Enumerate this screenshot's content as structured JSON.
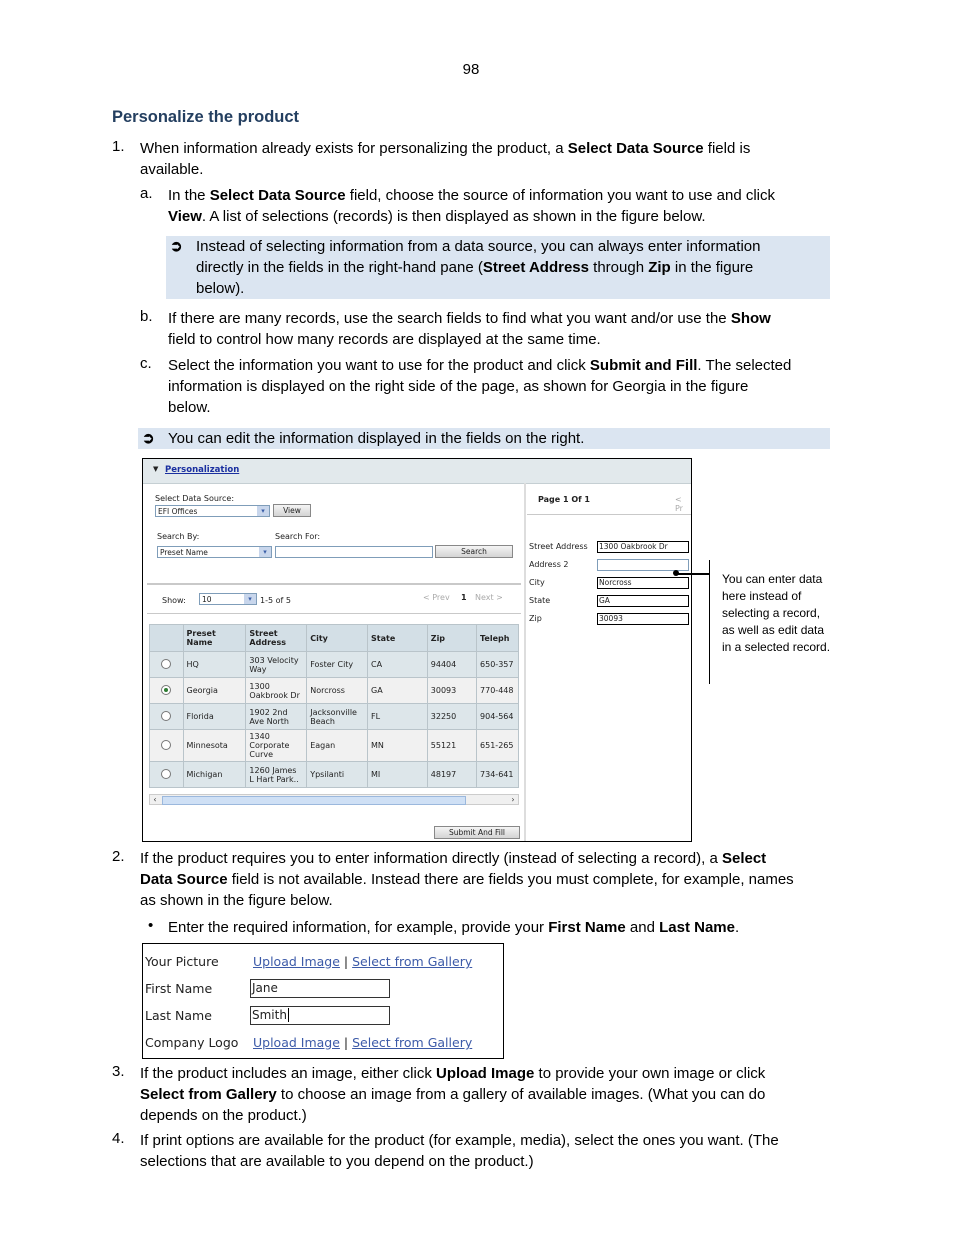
{
  "page_number": "98",
  "heading": "Personalize the product",
  "steps": {
    "s1": {
      "num": "1.",
      "pre": "When information already exists for personalizing the product, a ",
      "b1": "Select Data Source",
      "post": " field is",
      "line2": "available."
    },
    "s1a": {
      "num": "a.",
      "pre": "In the ",
      "b1": "Select Data Source",
      "mid": " field, choose the source of information you want to use and click",
      "b2": "View",
      "post": ". A list of selections (records) is then displayed as shown in the figure below."
    },
    "note1": {
      "line1": "Instead of selecting information from a data source, you can always enter information",
      "pre2": "directly in the fields in the right-hand pane (",
      "b1": "Street Address",
      "mid": " through ",
      "b2": "Zip",
      "post2": " in the figure",
      "line3": "below)."
    },
    "s1b": {
      "num": "b.",
      "pre": "If there are many records, use the search fields to find what you want and/or use the ",
      "b1": "Show",
      "line2": "field to control how many records are displayed at the same time."
    },
    "s1c": {
      "num": "c.",
      "pre": "Select the information you want to use for the product and click ",
      "b1": "Submit and Fill",
      "post": ". The selected",
      "line2": "information is displayed on the right side of the page, as shown for Georgia in the figure",
      "line3": "below."
    },
    "note2": {
      "text": "You can edit the information displayed in the fields on the right."
    },
    "s2": {
      "num": "2.",
      "pre": "If the product requires you to enter information directly (instead of selecting a record), a ",
      "b1": "Select",
      "b1b": "Data Source",
      "post": " field is not available. Instead there are fields you must complete, for example, names",
      "line3": "as shown in the figure below."
    },
    "bullet1": {
      "pre": "Enter the required information, for example, provide your ",
      "b1": "First Name",
      "mid": " and ",
      "b2": "Last Name",
      "post": "."
    },
    "s3": {
      "num": "3.",
      "pre": "If the product includes an image, either click ",
      "b1": "Upload Image",
      "post": " to provide your own image or click",
      "b2": "Select from Gallery",
      "post2": " to choose an image from a gallery of available images. (What you can do",
      "line3": "depends on the product.)"
    },
    "s4": {
      "num": "4.",
      "line1": "If print options are available for the product (for example, media), select the ones you want. (The",
      "line2": "selections that are available to you depend on the product.)"
    }
  },
  "note_arrow_glyph": "➲",
  "figure1": {
    "section_title": "Personalization",
    "data_source_label": "Select Data Source:",
    "data_source_value": "EFI Offices",
    "view_button": "View",
    "search_by_label": "Search By:",
    "search_by_value": "Preset Name",
    "search_for_label": "Search For:",
    "search_for_value": "",
    "search_button": "Search",
    "show_label": "Show:",
    "show_value": "10",
    "range_text": "1-5 of 5",
    "prev": "< Prev",
    "page": "1",
    "next": "Next >",
    "columns": [
      "",
      "Preset Name",
      "Street Address",
      "City",
      "State",
      "Zip",
      "Teleph"
    ],
    "rows": [
      {
        "selected": false,
        "name": "HQ",
        "street": "303 Velocity Way",
        "city": "Foster City",
        "state": "CA",
        "zip": "94404",
        "phone": "650-357"
      },
      {
        "selected": true,
        "name": "Georgia",
        "street": "1300 Oakbrook Dr",
        "city": "Norcross",
        "state": "GA",
        "zip": "30093",
        "phone": "770-448"
      },
      {
        "selected": false,
        "name": "Florida",
        "street": "1902 2nd Ave North",
        "city": "Jacksonville Beach",
        "state": "FL",
        "zip": "32250",
        "phone": "904-564"
      },
      {
        "selected": false,
        "name": "Minnesota",
        "street": "1340 Corporate Curve",
        "city": "Eagan",
        "state": "MN",
        "zip": "55121",
        "phone": "651-265"
      },
      {
        "selected": false,
        "name": "Michigan",
        "street": "1260 James L Hart Park..",
        "city": "Ypsilanti",
        "state": "MI",
        "zip": "48197",
        "phone": "734-641"
      }
    ],
    "submit_button": "Submit And Fill",
    "right_pane": {
      "page_text": "Page 1 Of 1",
      "prev_partial": "< Pr",
      "fields": [
        {
          "label": "Street Address",
          "value": "1300 Oakbrook Dr"
        },
        {
          "label": "Address 2",
          "value": ""
        },
        {
          "label": "City",
          "value": "Norcross"
        },
        {
          "label": "State",
          "value": "GA"
        },
        {
          "label": "Zip",
          "value": "30093"
        }
      ]
    },
    "callout": "You can enter data here instead of selecting a record, as well as edit data in a selected record."
  },
  "figure2": {
    "your_picture_label": "Your Picture",
    "upload_image": "Upload Image",
    "separator": "|",
    "select_gallery": "Select from Gallery",
    "first_name_label": "First Name",
    "first_name_value": "Jane",
    "last_name_label": "Last Name",
    "last_name_value": "Smith",
    "company_logo_label": "Company Logo"
  }
}
